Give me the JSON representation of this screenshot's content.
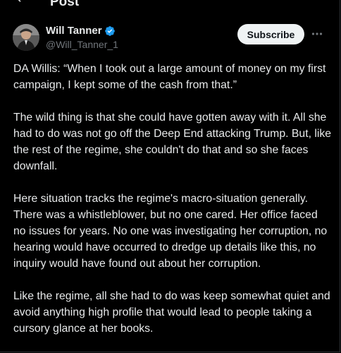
{
  "topbar": {
    "title": "Post"
  },
  "author": {
    "display_name": "Will Tanner",
    "handle": "@Will_Tanner_1",
    "verified": true
  },
  "actions": {
    "subscribe_label": "Subscribe"
  },
  "post": {
    "paragraphs": [
      "DA Willis: “When I took out a large amount of money on my first campaign, I kept some of the cash from that.”",
      "The wild thing is that she could have gotten away with it. All she had to do was not go off the Deep End attacking Trump. But, like the rest of the regime, she couldn't do that and so she faces downfall.",
      "Here situation tracks the regime's macro-situation generally. There was a whistleblower, but no one cared. Her office faced no issues for years. No one was investigating her corruption, no hearing would have occurred to dredge up details like this, no inquiry would have found out about her corruption.",
      "Like the regime, all she had to do was keep somewhat quiet and avoid anything high profile that would lead to people taking a cursory glance at her books."
    ]
  },
  "icons": {
    "back": "arrow-left-icon",
    "verified": "verified-badge-icon",
    "more": "more-horizontal-icon"
  },
  "colors": {
    "background": "#000000",
    "text": "#e7e9ea",
    "muted": "#71767b",
    "verified_blue": "#1d9bf0",
    "button_bg": "#eff3f4"
  }
}
